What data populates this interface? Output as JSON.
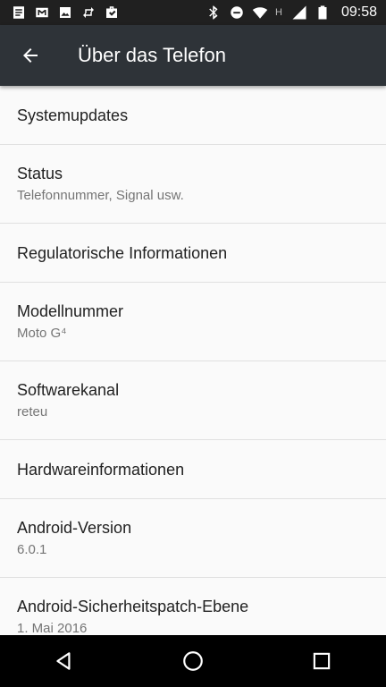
{
  "status_bar": {
    "notification_icons": [
      "doc-icon",
      "gmail-icon",
      "image-icon",
      "sync-icon",
      "briefcase-check-icon"
    ],
    "system_icons": [
      "bluetooth-icon",
      "do-not-disturb-icon",
      "wifi-icon",
      "cell-signal-icon",
      "battery-icon"
    ],
    "network_letter": "H",
    "time": "09:58"
  },
  "toolbar": {
    "back_icon": "arrow-back-icon",
    "title": "Über das Telefon",
    "background": "#2e3338"
  },
  "settings": [
    {
      "title": "Systemupdates"
    },
    {
      "title": "Status",
      "subtitle": "Telefonnummer, Signal usw."
    },
    {
      "title": "Regulatorische Informationen"
    },
    {
      "title": "Modellnummer",
      "subtitle": "Moto G⁴"
    },
    {
      "title": "Softwarekanal",
      "subtitle": "reteu"
    },
    {
      "title": "Hardwareinformationen"
    },
    {
      "title": "Android-Version",
      "subtitle": "6.0.1"
    },
    {
      "title": "Android-Sicherheitspatch-Ebene",
      "subtitle": "1. Mai 2016"
    }
  ],
  "nav_bar": {
    "buttons": [
      "back-triangle-icon",
      "home-circle-icon",
      "recents-square-icon"
    ]
  }
}
